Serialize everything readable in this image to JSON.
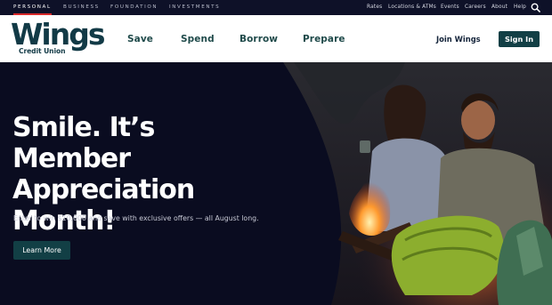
{
  "segments": [
    {
      "label": "Personal",
      "active": true
    },
    {
      "label": "Business",
      "active": false
    },
    {
      "label": "Foundation",
      "active": false
    },
    {
      "label": "Investments",
      "active": false
    }
  ],
  "utility_links": [
    "Rates",
    "Locations & ATMs",
    "Events",
    "Careers",
    "About",
    "Help"
  ],
  "search_icon": "search-icon",
  "logo": {
    "name": "Wings",
    "subtitle": "Credit Union"
  },
  "nav": [
    "Save",
    "Spend",
    "Borrow",
    "Prepare"
  ],
  "join_label": "Join Wings",
  "signin_label": "Sign In",
  "hero": {
    "title": "Smile. It’s Member Appreciation Month!",
    "subtitle": "Enter to win $10,000 and save with exclusive offers — all August long.",
    "cta_label": "Learn More"
  },
  "colors": {
    "brand_teal": "#123f45",
    "accent_red": "#d9292a",
    "hero_bg": "#0a0c20"
  }
}
